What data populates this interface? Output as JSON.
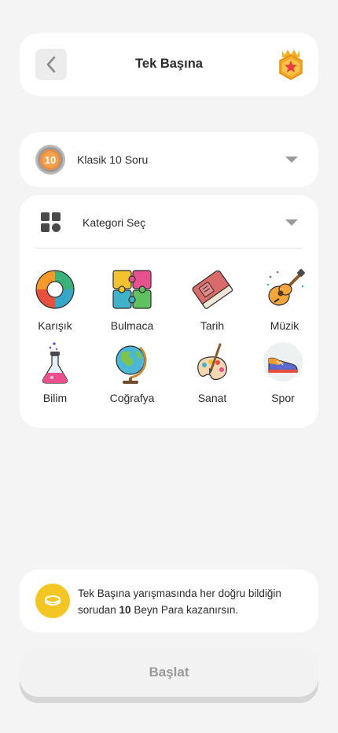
{
  "header": {
    "title": "Tek Başına"
  },
  "mode": {
    "icon_number": "10",
    "label": "Klasik 10 Soru"
  },
  "category": {
    "label": "Kategori Seç",
    "items": [
      {
        "label": "Karışık",
        "icon": "mixed-ring-icon"
      },
      {
        "label": "Bulmaca",
        "icon": "puzzle-icon"
      },
      {
        "label": "Tarih",
        "icon": "book-icon"
      },
      {
        "label": "Müzik",
        "icon": "guitar-icon"
      },
      {
        "label": "Bilim",
        "icon": "flask-icon"
      },
      {
        "label": "Coğrafya",
        "icon": "globe-icon"
      },
      {
        "label": "Sanat",
        "icon": "palette-icon"
      },
      {
        "label": "Spor",
        "icon": "sneaker-icon"
      }
    ]
  },
  "info": {
    "text_before": "Tek Başına yarışmasında her doğru bildiğin sorudan ",
    "amount": "10",
    "text_after": " Beyn Para kazanırsın."
  },
  "start": {
    "label": "Başlat"
  },
  "colors": {
    "background": "#f4f4f4",
    "card": "#ffffff",
    "coin": "#f4c623",
    "disabled_text": "#9a9a9a"
  }
}
